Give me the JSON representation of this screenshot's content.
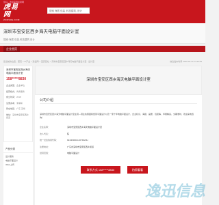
{
  "top": {
    "welcome": "您好，欢迎来到虎易网",
    "logo_main": "虎易网",
    "logo_sub": "ZOOSOE.COM",
    "search_placeholder": "搜索 海居 包装 ,科技建筑, 设计"
  },
  "banner": {
    "title": "深圳市宝安区西乡海天电脑平面设计室",
    "sub": "搜索:海居 包装,科技建筑 设计"
  },
  "nav": {
    "item": "企业首页"
  },
  "crumb": {
    "text": "您当前的位置：首页 > IT产业 > 建设网 > 宝安区社 > 深圳市宝安区西乡海天电脑平面设计室 · 设计室",
    "time": "信息发布时间 2020-03-10 14:40:59"
  },
  "sidebar": {
    "title": "深圳市宝安区西乡海天电脑平面设计室",
    "phone": "158*****8830",
    "rows": [
      {
        "k": "企业类型：",
        "v": "企业单位"
      },
      {
        "k": "经营模式：",
        "v": "商务服务"
      },
      {
        "k": "成立时间：",
        "v": "2018"
      },
      {
        "k": "注册资本：",
        "v": "未填写"
      },
      {
        "k": "所在地区：",
        "v": "广东 深圳"
      },
      {
        "k": "地址：",
        "v": "深圳市宝安区西乡街道"
      }
    ],
    "products_head": "产品分类",
    "products": [
      "设计服务",
      "电脑平面设计",
      "IDEA上传"
    ]
  },
  "main": {
    "hero_title": "深圳市宝安区西乡海天电脑平面设计室",
    "section_head": "公司介绍",
    "intro": "深圳市宝安区西乡海天电脑平面设计室主营—营业执照面积经营平面设计以及一家十年电脑平面设计、企业标识、海报、画册、包装等、印刷精良，交期准时，欢迎来电咨询！",
    "rows": [
      {
        "k": "企业名称：",
        "v": "深圳市宝安区西乡海天电脑平面设计室"
      },
      {
        "k": "法人代表：",
        "v": "陈"
      },
      {
        "k": "统一社会信用代码：",
        "v": "92440300L12074623H"
      },
      {
        "k": "注册地址：",
        "v": "广东省深圳市宝安区西乡街道"
      },
      {
        "k": "经营范围：",
        "v": "电脑平面设计"
      }
    ],
    "btn_contact": "联系方式 158*****8830",
    "btn_visit": "拍照看看"
  },
  "watermark": {
    "text": "逸迅信息"
  },
  "colors": {
    "brand": "#c8161d",
    "nav": "#b7141b",
    "phone": "#d21f2b"
  }
}
